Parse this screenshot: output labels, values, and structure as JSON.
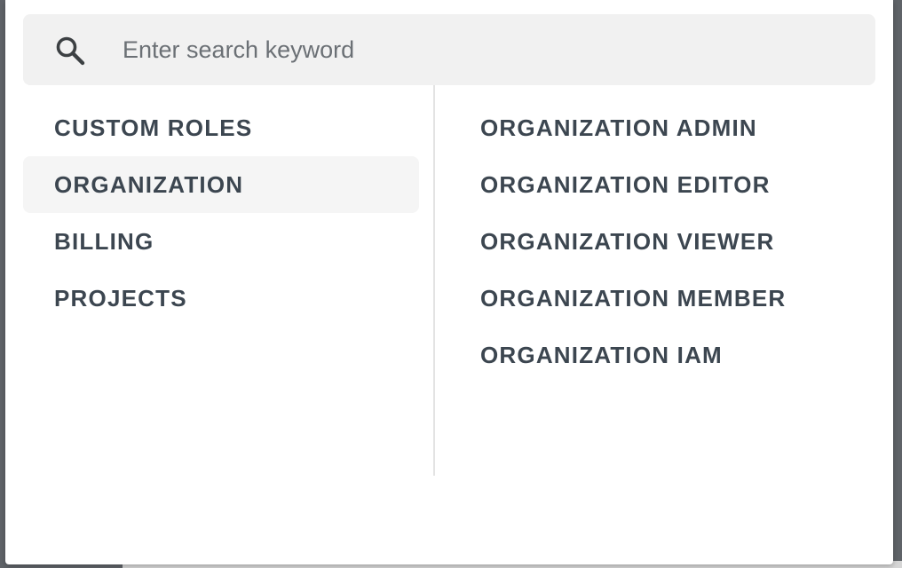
{
  "search": {
    "placeholder": "Enter search keyword",
    "value": "",
    "icon": "search-icon"
  },
  "categories": [
    {
      "label": "CUSTOM ROLES",
      "selected": false
    },
    {
      "label": "ORGANIZATION",
      "selected": true
    },
    {
      "label": "BILLING",
      "selected": false
    },
    {
      "label": "PROJECTS",
      "selected": false
    }
  ],
  "roles": [
    {
      "label": "ORGANIZATION ADMIN"
    },
    {
      "label": "ORGANIZATION EDITOR"
    },
    {
      "label": "ORGANIZATION VIEWER"
    },
    {
      "label": "ORGANIZATION MEMBER"
    },
    {
      "label": "ORGANIZATION IAM"
    }
  ],
  "colors": {
    "text": "#3c4650",
    "search_background": "#f1f1f1",
    "selected_background": "#f5f5f5",
    "divider": "#e3e3e3",
    "icon": "#3c4043"
  }
}
